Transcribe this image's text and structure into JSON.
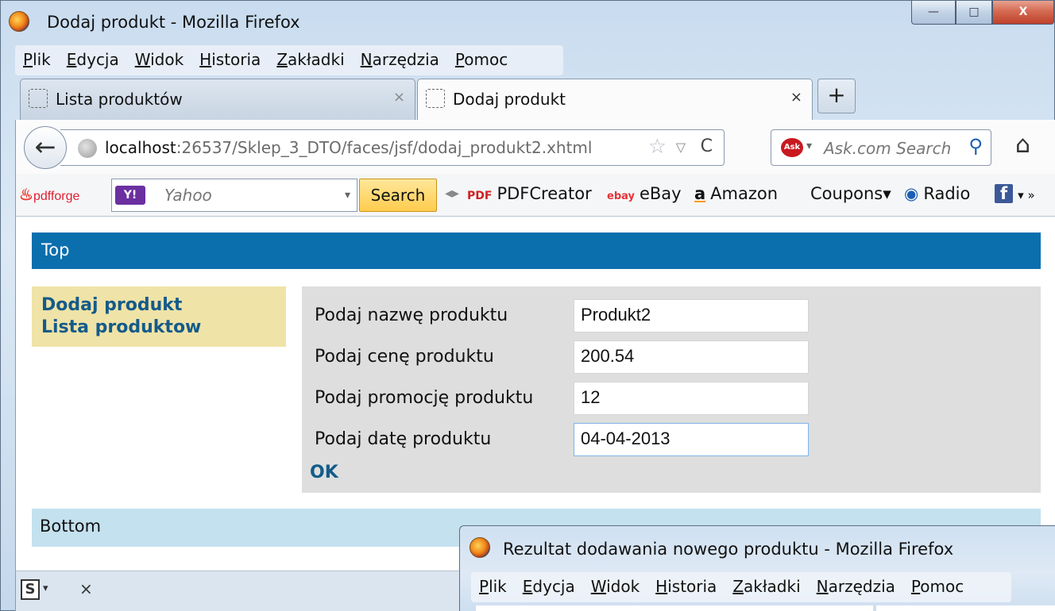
{
  "main_window": {
    "title": "Dodaj produkt - Mozilla Firefox",
    "controls": {
      "minimize": "—",
      "maximize": "□",
      "close": "X"
    },
    "menu": [
      "Plik",
      "Edycja",
      "Widok",
      "Historia",
      "Zakładki",
      "Narzędzia",
      "Pomoc"
    ],
    "tabs": [
      {
        "label": "Lista produktów",
        "close": "×"
      },
      {
        "label": "Dodaj produkt",
        "close": "×"
      }
    ],
    "new_tab": "+",
    "nav": {
      "back": "←",
      "url_host": "localhost",
      "url_rest": ":26537/Sklep_3_DTO/faces/jsf/dodaj_produkt2.xhtml",
      "star": "☆",
      "dropdown": "▽",
      "reload": "C",
      "search_logo": "Ask",
      "search_dropdown": "▾",
      "search_placeholder": "Ask.com Search",
      "search_icon": "⚲",
      "home": "⌂"
    },
    "toolbar": {
      "pdfforge": "pdfforge",
      "yahoo_logo": "Y!",
      "yahoo_placeholder": "Yahoo",
      "yahoo_dropdown": "▾",
      "search_button": "Search",
      "separator": "◂▸",
      "items": [
        {
          "icon": "PDF",
          "label": "PDFCreator"
        },
        {
          "icon": "ebay",
          "label": "eBay"
        },
        {
          "icon": "a",
          "label": "Amazon"
        },
        {
          "icon": "",
          "label": "Coupons▾"
        },
        {
          "icon": "◉",
          "label": "Radio"
        },
        {
          "icon": "f",
          "label": "▾ »"
        }
      ]
    }
  },
  "page": {
    "top": "Top",
    "nav_links": [
      "Dodaj produkt",
      "Lista produktow"
    ],
    "form": {
      "fields": [
        {
          "label": "Podaj nazwę produktu",
          "value": "Produkt2"
        },
        {
          "label": "Podaj cenę produktu",
          "value": "200.54"
        },
        {
          "label": "Podaj promocję produktu",
          "value": "12"
        },
        {
          "label": "Podaj datę produktu",
          "value": "04-04-2013"
        }
      ],
      "submit": "OK"
    },
    "bottom": "Bottom"
  },
  "statusbar": {
    "s_icon": "S",
    "s_drop": "▾",
    "close": "×"
  },
  "second_window": {
    "title": "Rezultat dodawania nowego produktu - Mozilla Firefox",
    "menu": [
      "Plik",
      "Edycja",
      "Widok",
      "Historia",
      "Zakładki",
      "Narzędzia",
      "Pomoc"
    ]
  }
}
